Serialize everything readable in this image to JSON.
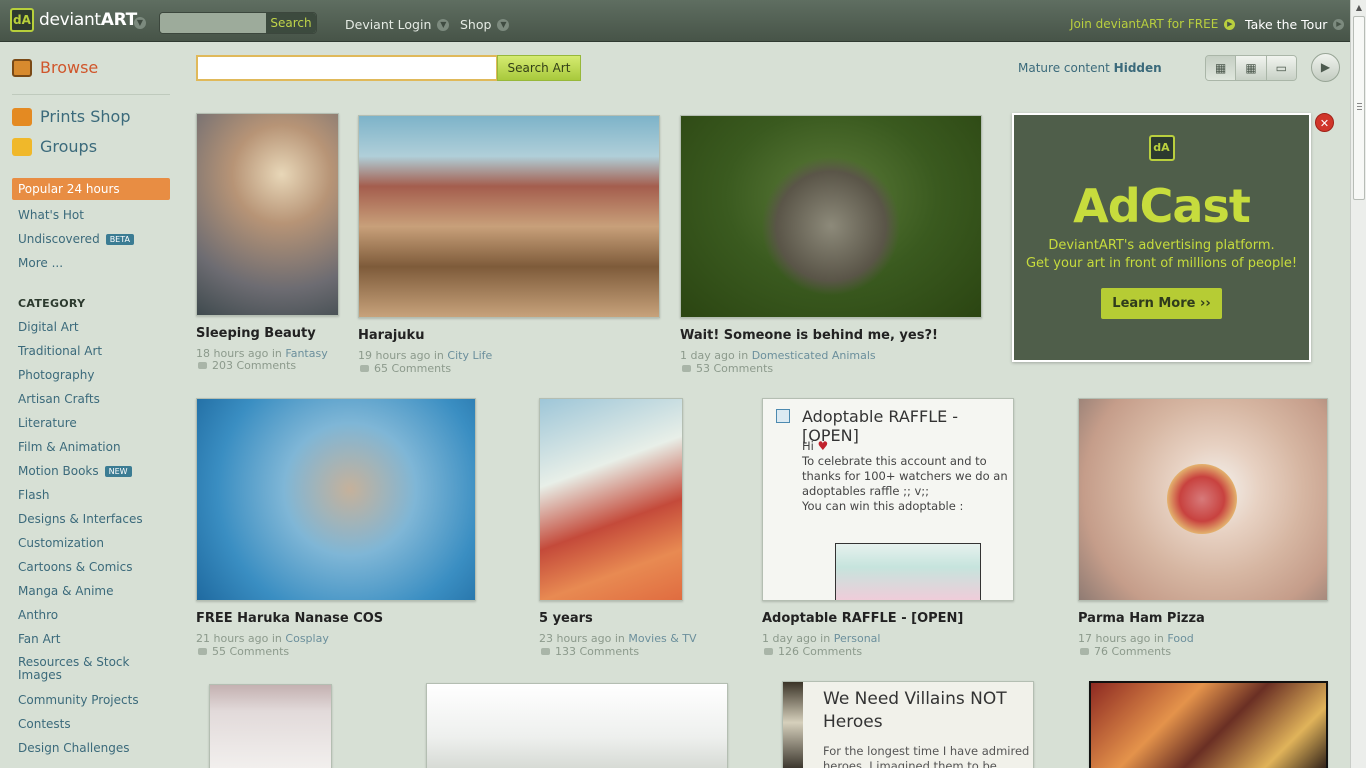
{
  "app": {
    "name_light": "deviant",
    "name_bold": "ART"
  },
  "topbar": {
    "search_btn": "Search",
    "login": "Deviant Login",
    "shop": "Shop",
    "join": "Join deviantART for FREE",
    "tour": "Take the Tour"
  },
  "sidebar": {
    "browse": "Browse",
    "prints": "Prints Shop",
    "groups": "Groups",
    "popular": "Popular 24 hours",
    "whats_hot": "What's Hot",
    "undiscovered": "Undiscovered",
    "undiscovered_badge": "BETA",
    "more": "More ...",
    "category_head": "CATEGORY",
    "categories": [
      "Digital Art",
      "Traditional Art",
      "Photography",
      "Artisan Crafts",
      "Literature",
      "Film & Animation",
      "Motion Books",
      "Flash",
      "Designs & Interfaces",
      "Customization",
      "Cartoons & Comics",
      "Manga & Anime",
      "Anthro",
      "Fan Art",
      "Resources & Stock Images",
      "Community Projects",
      "Contests",
      "Design Challenges"
    ],
    "motion_badge": "NEW"
  },
  "main": {
    "search_btn": "Search Art",
    "mature_label": "Mature content",
    "mature_value": "Hidden"
  },
  "items": [
    {
      "title": "Sleeping Beauty",
      "time": "18 hours ago in",
      "cat": "Fantasy",
      "comments": "203 Comments"
    },
    {
      "title": "Harajuku",
      "time": "19 hours ago in",
      "cat": "City Life",
      "comments": "65 Comments"
    },
    {
      "title": "Wait! Someone is behind me, yes?!",
      "time": "1 day ago in",
      "cat": "Domesticated Animals",
      "comments": "53 Comments"
    },
    {
      "title": "FREE Haruka Nanase COS",
      "time": "21 hours ago in",
      "cat": "Cosplay",
      "comments": "55 Comments"
    },
    {
      "title": "5 years",
      "time": "23 hours ago in",
      "cat": "Movies & TV",
      "comments": "133 Comments"
    },
    {
      "title": "Adoptable RAFFLE - [OPEN]",
      "time": "1 day ago in",
      "cat": "Personal",
      "comments": "126 Comments"
    },
    {
      "title": "Parma Ham Pizza",
      "time": "17 hours ago in",
      "cat": "Food",
      "comments": "76 Comments"
    }
  ],
  "raffle_card": {
    "title": "Adoptable RAFFLE - [OPEN]",
    "hi": "Hi",
    "body": "To celebrate this account and to thanks for 100+ watchers we do an adoptables raffle ;; v;;",
    "win": "You can win this adoptable :"
  },
  "villains_card": {
    "title": "We Need Villains NOT Heroes",
    "body": "For the longest time I have admired heroes. I imagined them to be"
  },
  "ad": {
    "title": "AdCast",
    "line1": "DeviantART's advertising platform.",
    "line2": "Get your art in front of millions of people!",
    "button": "Learn More ››"
  }
}
